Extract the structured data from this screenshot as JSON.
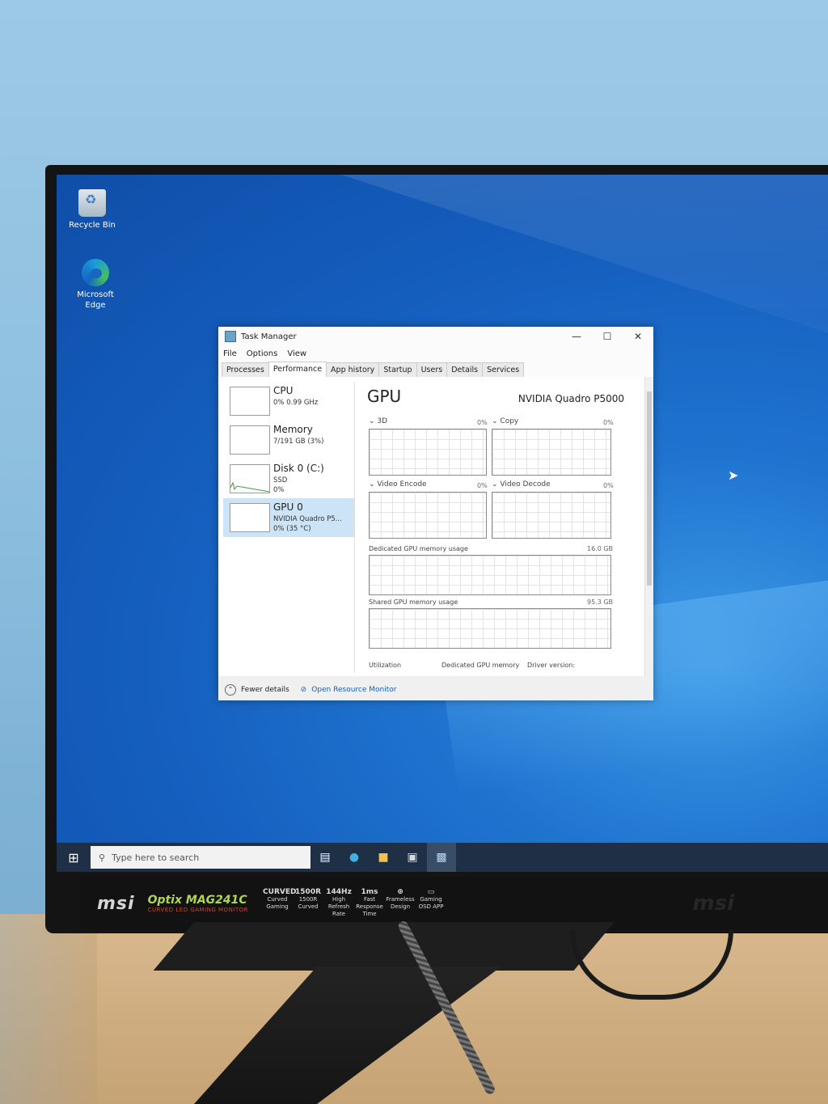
{
  "desktop": {
    "icons": [
      {
        "label": "Recycle Bin"
      },
      {
        "label": "Microsoft Edge"
      }
    ]
  },
  "task_manager": {
    "title": "Task Manager",
    "menu": [
      "File",
      "Options",
      "View"
    ],
    "tabs": [
      "Processes",
      "Performance",
      "App history",
      "Startup",
      "Users",
      "Details",
      "Services"
    ],
    "active_tab": "Performance",
    "resources": [
      {
        "name": "CPU",
        "line1": "0% 0.99 GHz",
        "line2": ""
      },
      {
        "name": "Memory",
        "line1": "7/191 GB (3%)",
        "line2": ""
      },
      {
        "name": "Disk 0 (C:)",
        "line1": "SSD",
        "line2": "0%"
      },
      {
        "name": "GPU 0",
        "line1": "NVIDIA Quadro P5...",
        "line2": "0% (35 °C)"
      }
    ],
    "selected_resource": "GPU 0",
    "detail": {
      "title": "GPU",
      "model": "NVIDIA Quadro P5000",
      "engines": [
        {
          "label": "3D",
          "pct": "0%"
        },
        {
          "label": "Copy",
          "pct": "0%"
        },
        {
          "label": "Video Encode",
          "pct": "0%"
        },
        {
          "label": "Video Decode",
          "pct": "0%"
        }
      ],
      "dedicated_label": "Dedicated GPU memory usage",
      "dedicated_max": "16.0 GB",
      "shared_label": "Shared GPU memory usage",
      "shared_max": "95.3 GB",
      "bottom_labels": [
        "Utilization",
        "Dedicated GPU memory",
        "Driver version:"
      ]
    },
    "footer": {
      "fewer_details": "Fewer details",
      "resource_monitor": "Open Resource Monitor"
    }
  },
  "taskbar": {
    "search_placeholder": "Type here to search"
  },
  "monitor": {
    "brand": "msi",
    "model": "Optix MAG241C",
    "model_sub": "CURVED LED GAMING MONITOR",
    "badges": [
      {
        "top": "CURVED",
        "bottom": "Curved Gaming"
      },
      {
        "top": "1500R",
        "bottom": "1500R Curved"
      },
      {
        "top": "144Hz",
        "bottom": "High Refresh Rate"
      },
      {
        "top": "1ms",
        "bottom": "Fast Response Time"
      },
      {
        "top": "⊕",
        "bottom": "Frameless Design"
      },
      {
        "top": "▭",
        "bottom": "Gaming OSD APP"
      }
    ],
    "brand_right": "msi"
  }
}
